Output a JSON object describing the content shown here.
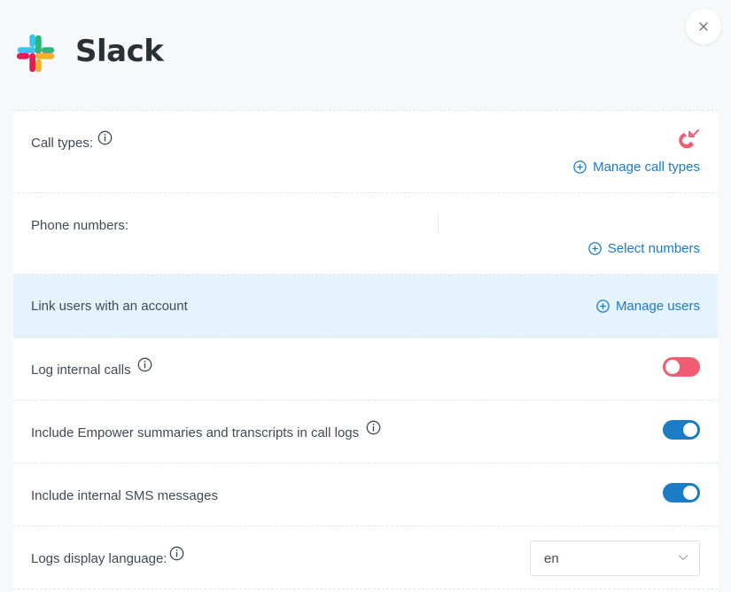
{
  "app": {
    "title": "Slack",
    "icon": "slack-logo",
    "close_icon": "close-icon"
  },
  "rows": {
    "call_types": {
      "label": "Call types:",
      "icon": "call-type-icon",
      "action": "Manage call types"
    },
    "phone_numbers": {
      "label": "Phone numbers:",
      "action": "Select numbers"
    },
    "link_users": {
      "label": "Link users with an account",
      "action": "Manage users"
    },
    "log_internal": {
      "label": "Log internal calls",
      "enabled": false
    },
    "include_empower": {
      "label": "Include Empower summaries and transcripts in call logs",
      "enabled": true
    },
    "include_sms": {
      "label": "Include internal SMS messages",
      "enabled": true
    },
    "display_language": {
      "label": "Logs display language:",
      "value": "en"
    }
  },
  "colors": {
    "accent": "#1b7bc4",
    "toggle_off": "#f25c72",
    "highlight_row": "#e5f3fc",
    "slack_blue": "#36c5f0",
    "slack_green": "#2eb67d",
    "slack_yellow": "#ecb22e",
    "slack_red": "#e01e5a"
  }
}
